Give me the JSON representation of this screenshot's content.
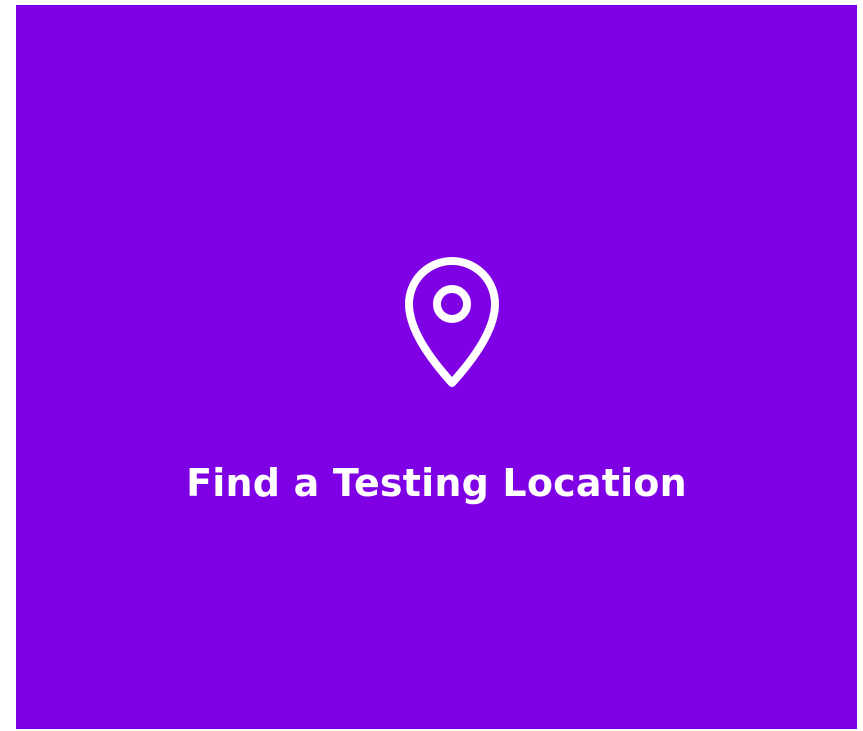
{
  "card": {
    "label": "Find a Testing Location",
    "icon": "location-pin-icon",
    "background_color": "#8000E6",
    "text_color": "#FFFFFF"
  }
}
